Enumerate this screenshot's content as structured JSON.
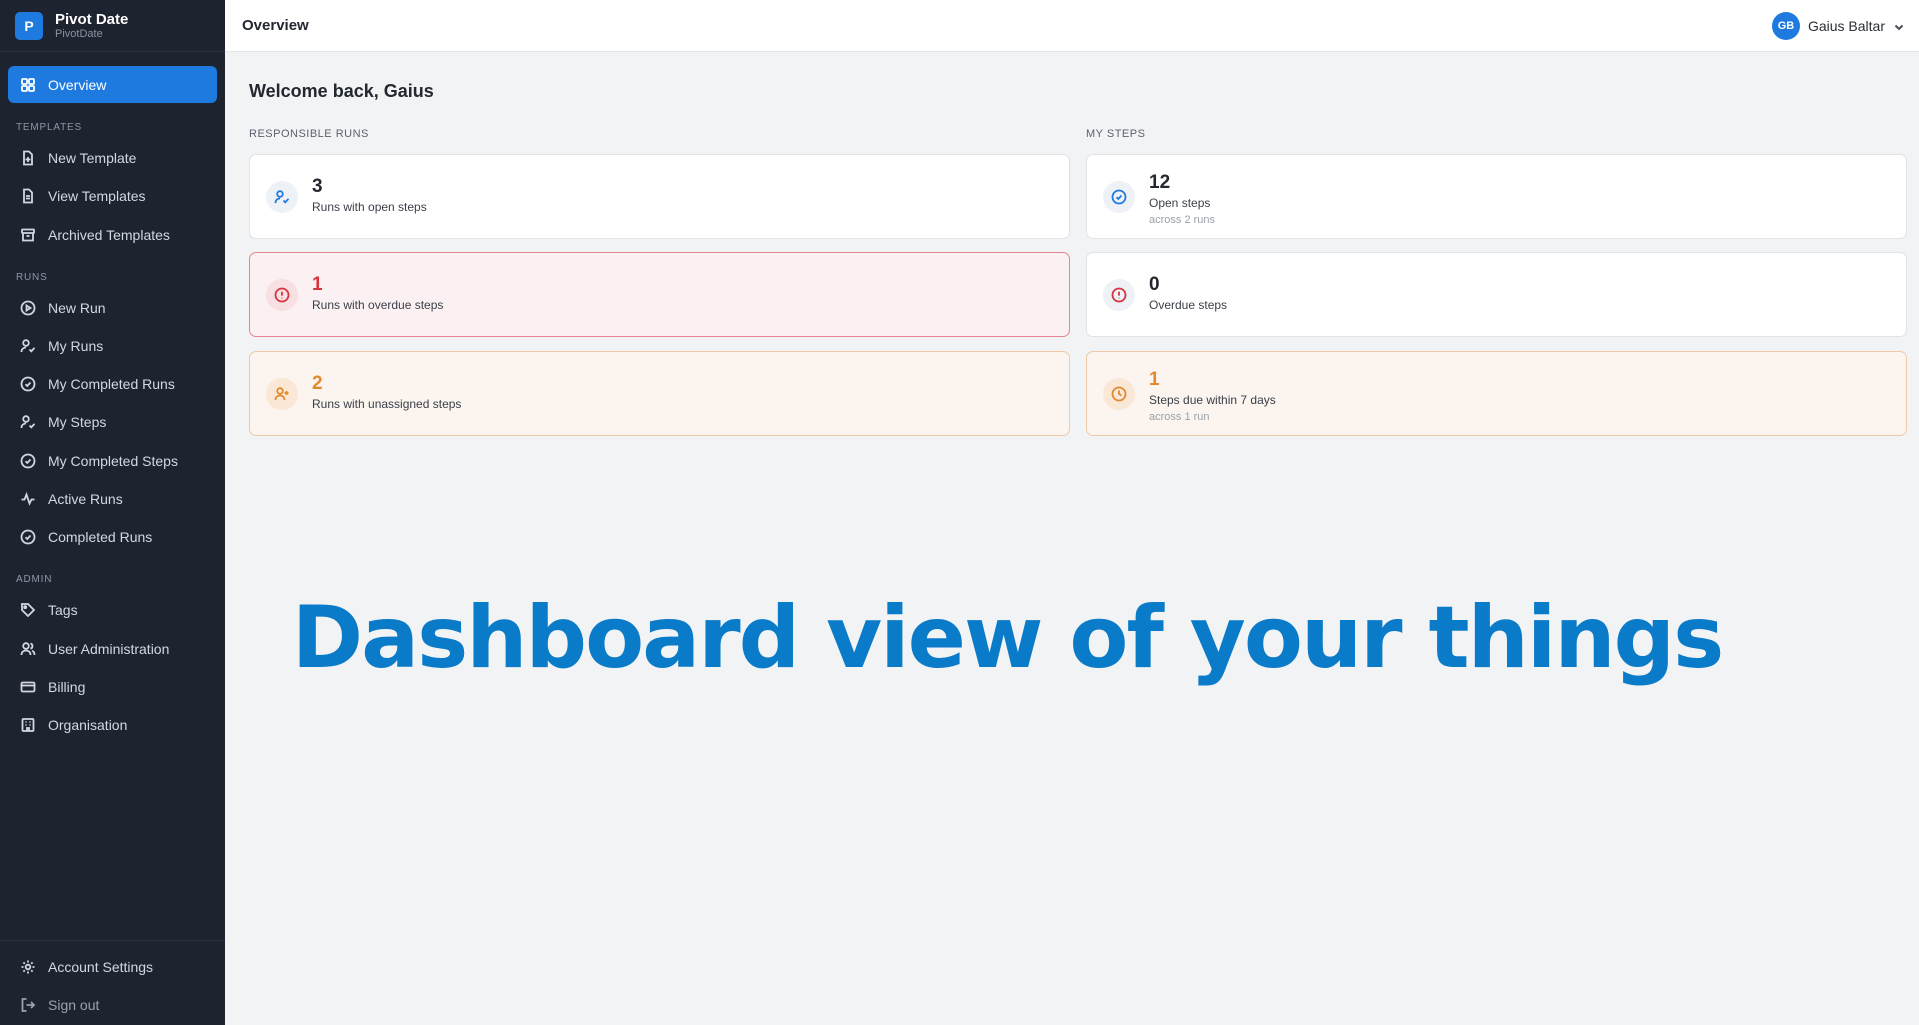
{
  "brand": {
    "logo_letter": "P",
    "name": "Pivot Date",
    "sub": "PivotDate"
  },
  "sidebar": {
    "overview": "Overview",
    "sections": {
      "templates": "TEMPLATES",
      "runs": "RUNS",
      "admin": "ADMIN"
    },
    "templates": [
      "New Template",
      "View Templates",
      "Archived Templates"
    ],
    "runs": [
      "New Run",
      "My Runs",
      "My Completed Runs",
      "My Steps",
      "My Completed Steps",
      "Active Runs",
      "Completed Runs"
    ],
    "admin": [
      "Tags",
      "User Administration",
      "Billing",
      "Organisation"
    ],
    "bottom": {
      "account_settings": "Account Settings",
      "sign_out": "Sign out"
    }
  },
  "header": {
    "title": "Overview",
    "user": {
      "initials": "GB",
      "name": "Gaius Baltar"
    }
  },
  "main": {
    "welcome": "Welcome back, Gaius",
    "responsible_runs": {
      "label": "RESPONSIBLE RUNS",
      "cards": [
        {
          "value": "3",
          "desc": "Runs with open steps",
          "sub": ""
        },
        {
          "value": "1",
          "desc": "Runs with overdue steps",
          "sub": ""
        },
        {
          "value": "2",
          "desc": "Runs with unassigned steps",
          "sub": ""
        }
      ]
    },
    "my_steps": {
      "label": "MY STEPS",
      "cards": [
        {
          "value": "12",
          "desc": "Open steps",
          "sub": "across 2 runs"
        },
        {
          "value": "0",
          "desc": "Overdue steps",
          "sub": ""
        },
        {
          "value": "1",
          "desc": "Steps due within 7 days",
          "sub": "across 1 run"
        }
      ]
    }
  },
  "banner": "Dashboard view of your things",
  "colors": {
    "accent": "#1f7ae0",
    "sidebar_bg": "#1e2330",
    "danger": "#d6333f",
    "warning": "#e08a2c",
    "banner": "#0a7bc8"
  }
}
